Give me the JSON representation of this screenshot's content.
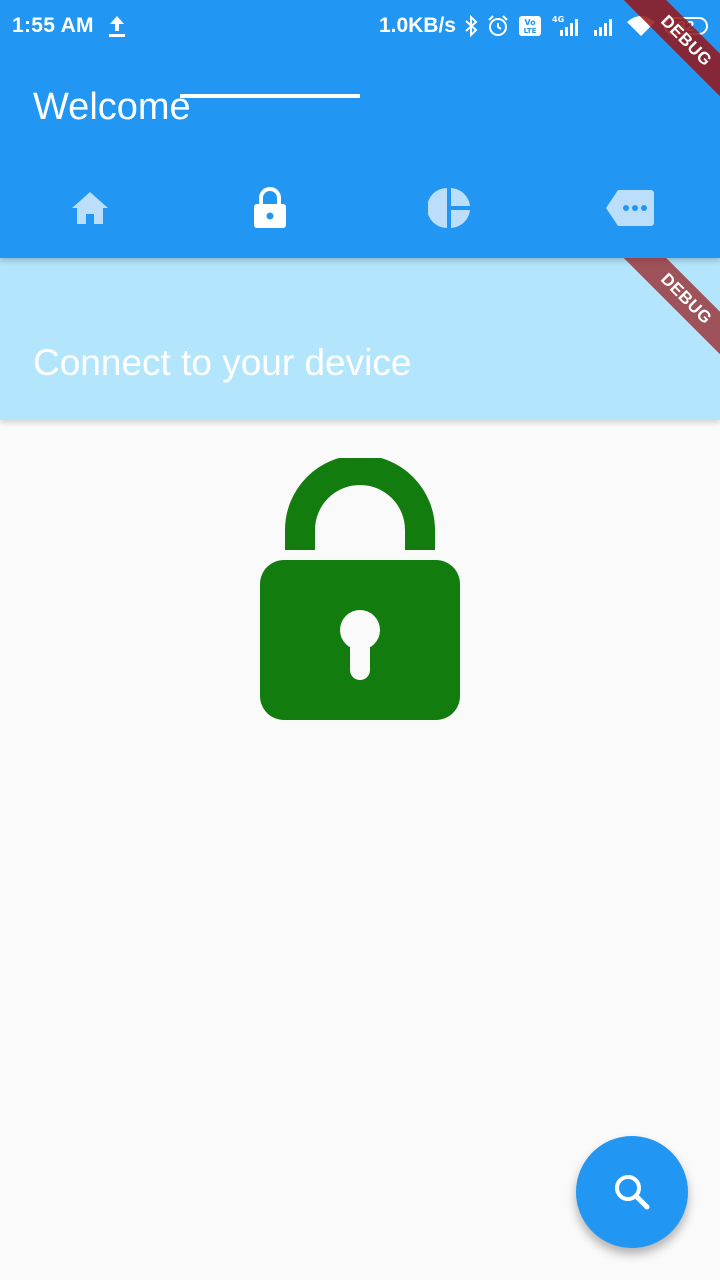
{
  "status_bar": {
    "time": "1:55 AM",
    "net_speed": "1.0KB/s",
    "battery": "32"
  },
  "app_bar": {
    "title": "Welcome",
    "tabs": [
      {
        "icon": "home-icon",
        "selected": false
      },
      {
        "icon": "lock-icon",
        "selected": true
      },
      {
        "icon": "pie-chart-icon",
        "selected": false
      },
      {
        "icon": "tag-more-icon",
        "selected": false
      }
    ]
  },
  "banner": {
    "text": "Connect to your device"
  },
  "content": {
    "icon": "lock-icon",
    "lock_color": "#127c0e"
  },
  "fab": {
    "icon": "search-icon"
  },
  "debug_banner": "DEBUG",
  "colors": {
    "primary": "#2196f3",
    "banner": "#b3e5fc",
    "tab_inactive": "#bbdefb"
  }
}
